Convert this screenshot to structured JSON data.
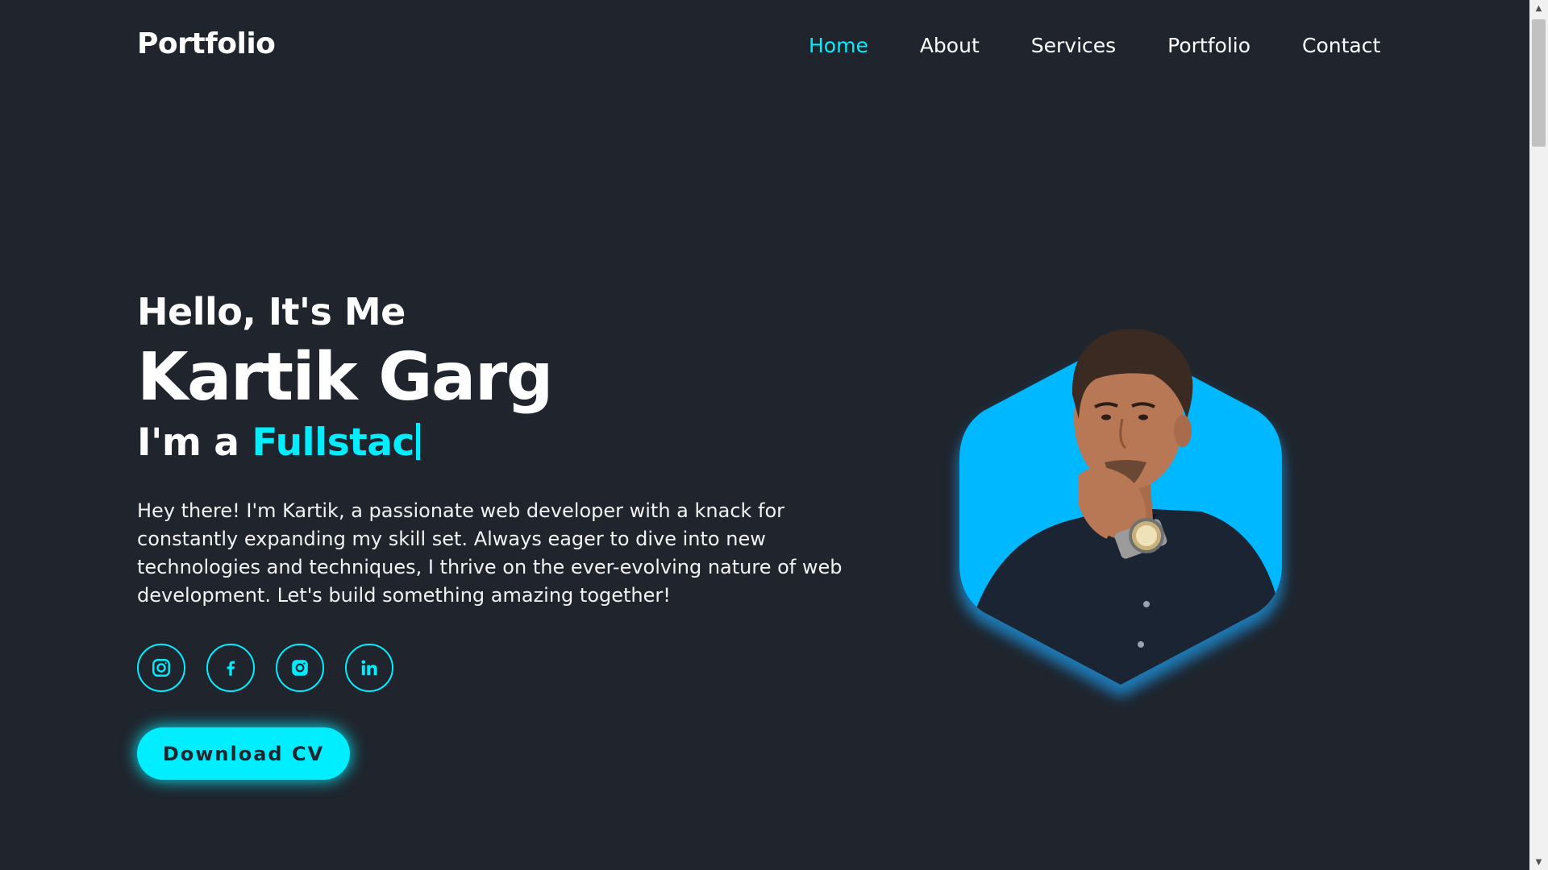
{
  "header": {
    "logo": "Portfolio",
    "nav": [
      {
        "label": "Home",
        "active": true
      },
      {
        "label": "About",
        "active": false
      },
      {
        "label": "Services",
        "active": false
      },
      {
        "label": "Portfolio",
        "active": false
      },
      {
        "label": "Contact",
        "active": false
      }
    ]
  },
  "hero": {
    "greeting": "Hello, It's Me",
    "name": "Kartik Garg",
    "role_prefix": "I'm a",
    "role_typed": "Fullstac",
    "bio": "Hey there! I'm Kartik, a passionate web developer with a knack for constantly expanding my skill set. Always eager to dive into new technologies and techniques, I thrive on the ever-evolving nature of web development. Let's build something amazing together!",
    "socials": [
      {
        "icon": "instagram-icon"
      },
      {
        "icon": "facebook-icon"
      },
      {
        "icon": "instagram-icon"
      },
      {
        "icon": "linkedin-icon"
      }
    ],
    "cta_label": "Download CV"
  },
  "colors": {
    "background": "#1f242d",
    "accent": "#00eeff",
    "text": "#ffffff",
    "portrait_bg": "#00b8ff"
  }
}
